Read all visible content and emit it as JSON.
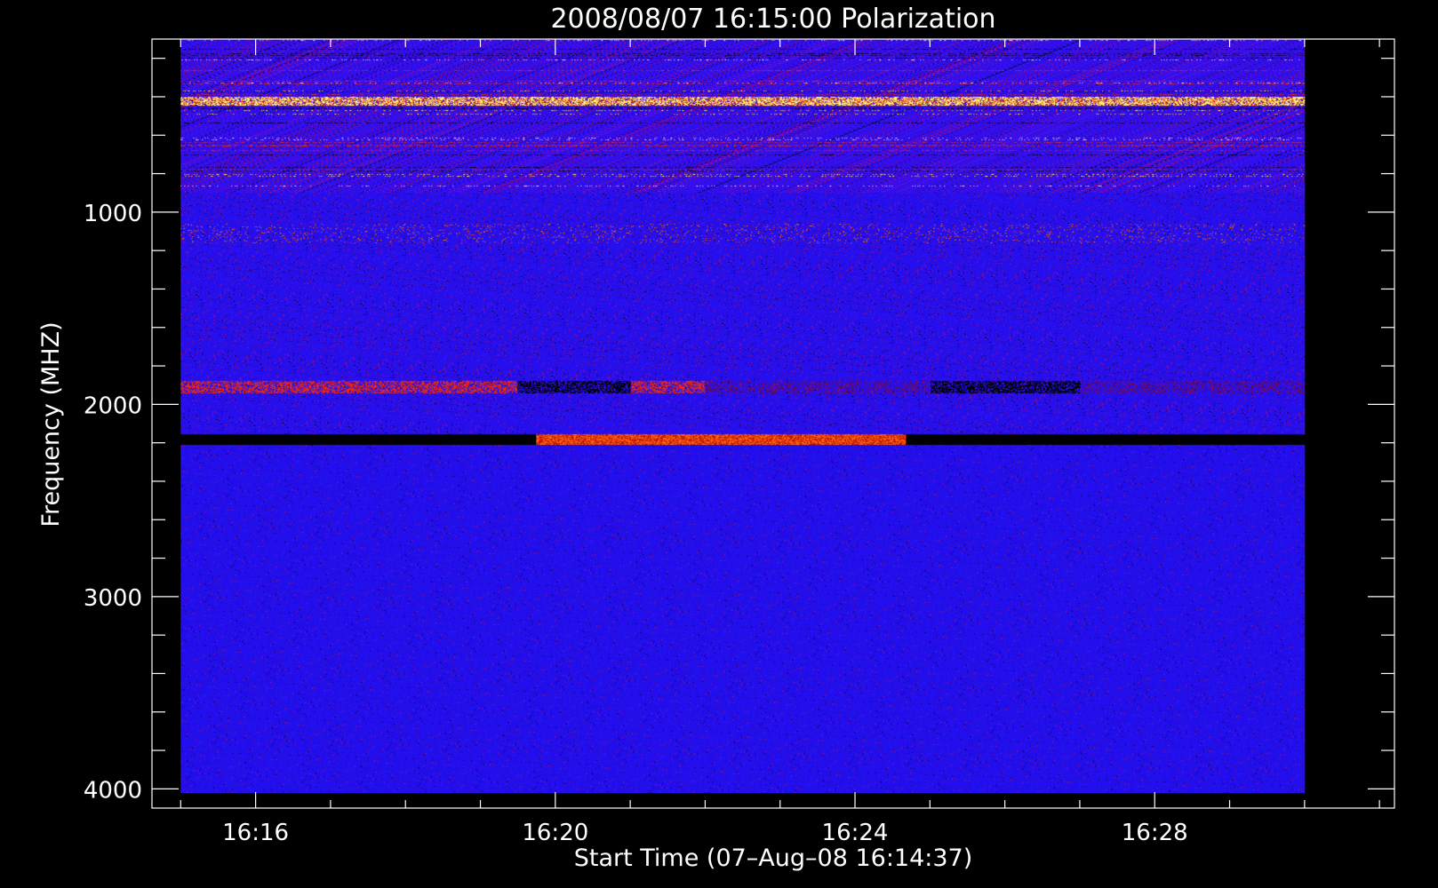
{
  "chart_data": {
    "type": "heatmap",
    "title": "2008/08/07 16:15:00 Polarization",
    "xlabel": "Start Time (07–Aug–08 16:14:37)",
    "ylabel": "Frequency (MHZ)",
    "x_ticks": [
      "16:16",
      "16:20",
      "16:24",
      "16:28"
    ],
    "y_ticks": [
      1000,
      2000,
      3000,
      4000
    ],
    "x_range": [
      "16:14:37",
      "16:31:12"
    ],
    "data_time_range": [
      "16:15:00",
      "16:30:00"
    ],
    "ylim": [
      100,
      4100
    ],
    "data_freq_range": [
      100,
      4020
    ],
    "y_inverted": true,
    "colormap": {
      "background": "#1a0aff",
      "low": "#000000",
      "mid": "#d01010",
      "high": "#ffff60"
    },
    "features": [
      {
        "freq": 120,
        "time_start": "16:15:00",
        "time_end": "16:30:00",
        "intensity": "high-variable"
      },
      {
        "freq": 420,
        "time_start": "16:15:00",
        "time_end": "16:30:00",
        "intensity": "high"
      },
      {
        "freq": 1100,
        "time_start": "16:15:00",
        "time_end": "16:30:00",
        "intensity": "mid-sparse"
      },
      {
        "freq": 1900,
        "time_start": "16:15:00",
        "time_end": "16:30:00",
        "intensity": "mixed"
      },
      {
        "freq": 2180,
        "time_start": "16:15:00",
        "time_end": "16:30:00",
        "intensity": "dark"
      },
      {
        "freq": 2180,
        "time_start": "16:19:45",
        "time_end": "16:24:40",
        "intensity": "high"
      }
    ]
  }
}
